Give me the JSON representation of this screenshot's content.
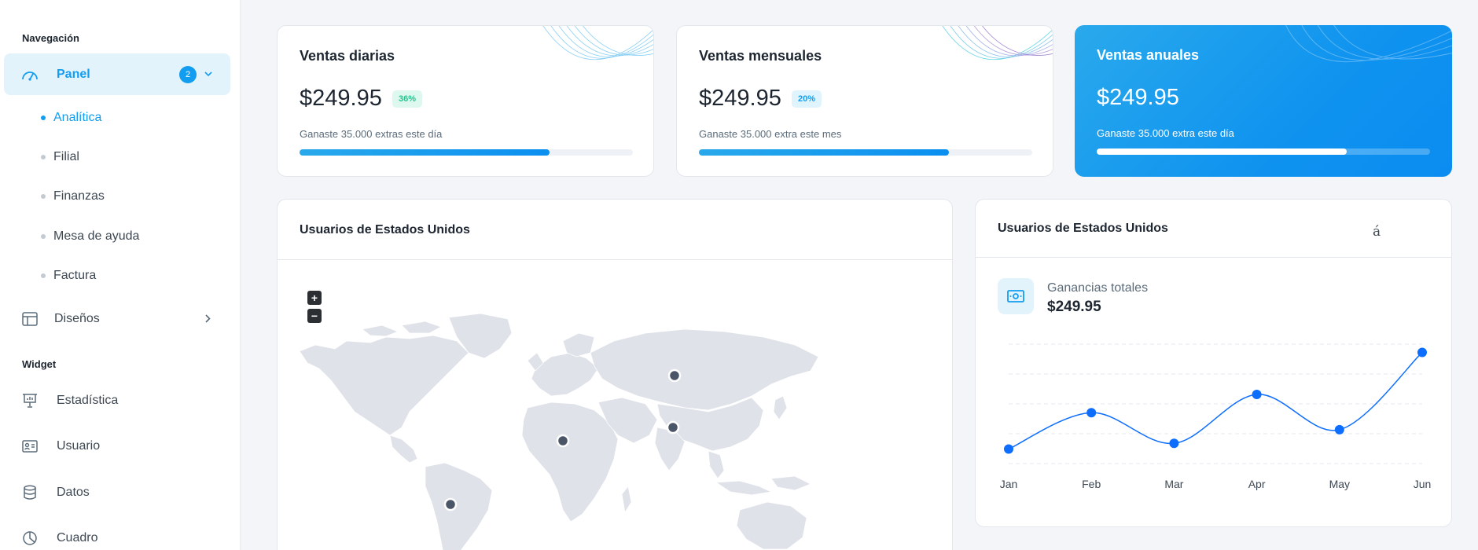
{
  "sidebar": {
    "nav_caption": "Navegación",
    "widget_caption": "Widget",
    "panel": {
      "label": "Panel",
      "badge": "2"
    },
    "sub_items": [
      "Analítica",
      "Filial",
      "Finanzas",
      "Mesa de ayuda",
      "Factura"
    ],
    "designs": {
      "label": "Diseños"
    },
    "widget_items": [
      "Estadística",
      "Usuario",
      "Datos",
      "Cuadro"
    ]
  },
  "stats": [
    {
      "title": "Ventas diarias",
      "value": "$249.95",
      "pill": "36%",
      "desc": "Ganaste 35.000 extras este día",
      "progress": 0.75
    },
    {
      "title": "Ventas mensuales",
      "value": "$249.95",
      "pill": "20%",
      "desc": "Ganaste 35.000 extra este mes",
      "progress": 0.75
    },
    {
      "title": "Ventas anuales",
      "value": "$249.95",
      "pill": "",
      "desc": "Ganaste 35.000 extra este día",
      "progress": 0.75
    }
  ],
  "map_card": {
    "title": "Usuarios de Estados Unidos",
    "zoom_in": "+",
    "zoom_out": "−"
  },
  "earnings_card": {
    "title": "Usuarios de Estados Unidos",
    "stray_char": "á",
    "label": "Ganancias totales",
    "value": "$249.95"
  },
  "chart_data": {
    "type": "line",
    "categories": [
      "Jan",
      "Feb",
      "Mar",
      "Apr",
      "May",
      "Jun"
    ],
    "series": [
      {
        "values": [
          10,
          42,
          15,
          58,
          27,
          95
        ]
      }
    ],
    "ylim": [
      0,
      105
    ],
    "grid": true,
    "color": "#0d6efd"
  },
  "colors": {
    "accent": "#139df0",
    "pill_green_bg": "#dff8ef",
    "pill_green_fg": "#22c58b",
    "pill_blue_bg": "#e0f4fd",
    "pill_blue_fg": "#139df0",
    "land": "#dfe2e8",
    "marker": "#4a5568"
  }
}
